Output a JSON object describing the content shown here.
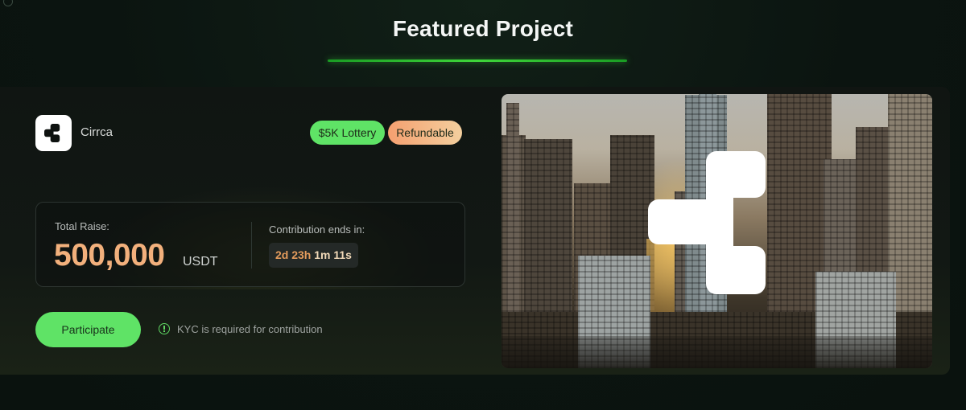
{
  "section": {
    "title": "Featured Project"
  },
  "project": {
    "name": "Cirrca",
    "logo_icon": "cirrca-logo-icon",
    "badges": {
      "lottery": "$5K Lottery",
      "refundable": "Refundable"
    }
  },
  "raise": {
    "label": "Total Raise:",
    "amount": "500,000",
    "unit": "USDT"
  },
  "countdown": {
    "label": "Contribution ends in:",
    "days_hours": "2d 23h",
    "min_sec": "1m 11s"
  },
  "actions": {
    "participate_label": "Participate",
    "kyc_icon": "info-circle-icon",
    "kyc_note": "KYC is required for contribution"
  },
  "colors": {
    "accent_green": "#5fe366",
    "amount_orange": "#f2b07c",
    "background": "#0c1511"
  }
}
